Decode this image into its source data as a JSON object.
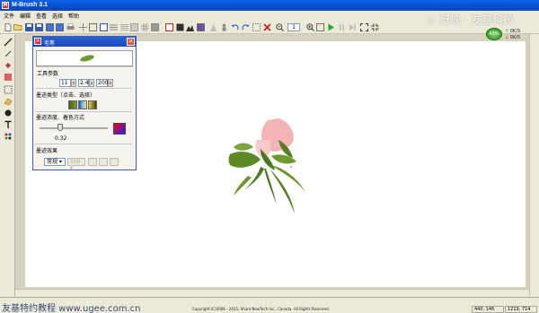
{
  "window": {
    "title": "M-Brush 3.1",
    "app_badge": "M"
  },
  "watermark_top": {
    "copyright_symbol": "©",
    "text": "万峡 · 友基科技"
  },
  "menu": [
    "文件",
    "编辑",
    "查看",
    "选择",
    "帮助"
  ],
  "toolbar": {
    "zoom_value": "1"
  },
  "net_monitor": {
    "percent": "43%",
    "up": "0K/S",
    "down": "0K/S"
  },
  "brush_panel": {
    "title": "毛笔",
    "badge": "M",
    "close": "×",
    "sections": {
      "tool_params": "工具参数",
      "ink_type": "墨迹类型（点击、选择）",
      "ink_strength": "墨迹浓度、着色方式",
      "ink_effect": "墨迹效果"
    },
    "params": [
      "11",
      "2.4",
      "200"
    ],
    "strength_value": "0.32",
    "effect_mode": "常规",
    "effect_mode_2": "100"
  },
  "statusbar": {
    "left_text": "友基特约教程 www.ugee.com.cn",
    "copyright": "Copyright (C)2006 - 2015, Share NewTech Inc., Canada. All Rights Reserved.",
    "coords": "440, 146",
    "canvas_size": "1219, 714"
  },
  "colors": {
    "title_blue": "#0a4fd0",
    "panel_border": "#3d5cc0",
    "canvas_bg": "#ffffff",
    "workspace_bg": "#d6d2bf",
    "petal_pink": "#f2b0b0",
    "leaf_green": "#4a7a1e"
  }
}
